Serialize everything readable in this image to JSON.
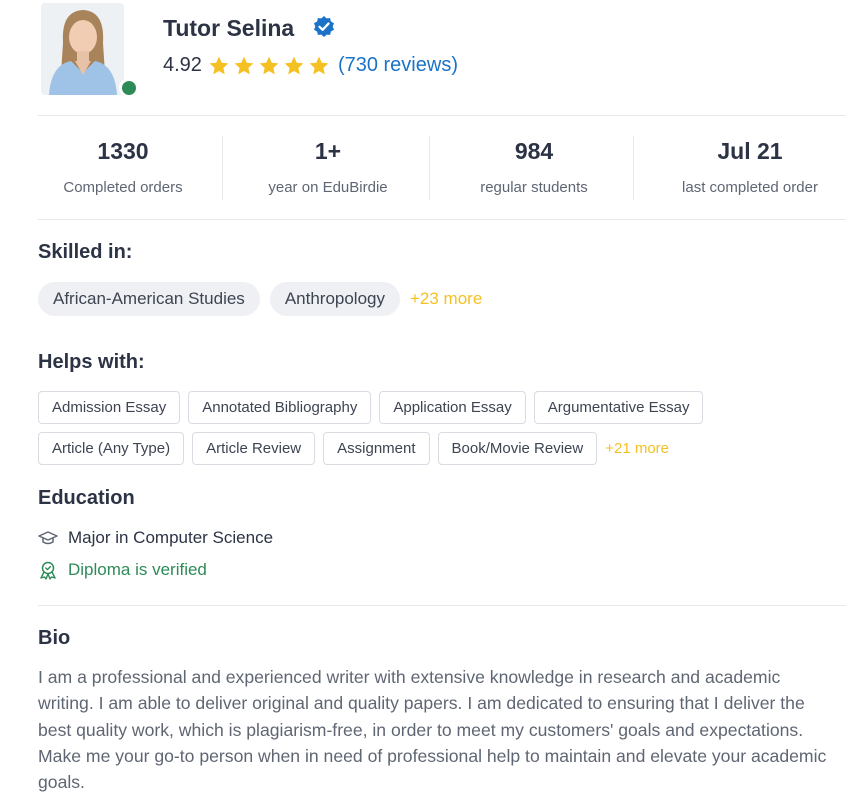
{
  "tutor": {
    "name": "Tutor Selina",
    "rating": "4.92",
    "stars": 5,
    "reviews_label": "(730 reviews)"
  },
  "stats": [
    {
      "value": "1330",
      "label": "Completed orders"
    },
    {
      "value": "1+",
      "label": "year on EduBirdie"
    },
    {
      "value": "984",
      "label": "regular students"
    },
    {
      "value": "Jul 21",
      "label": "last completed order"
    }
  ],
  "skills": {
    "title": "Skilled in:",
    "items": [
      "African-American Studies",
      "Anthropology"
    ],
    "more_label": "+23 more"
  },
  "helps": {
    "title": "Helps with:",
    "row1": [
      "Admission Essay",
      "Annotated Bibliography",
      "Application Essay",
      "Argumentative Essay"
    ],
    "row2": [
      "Article (Any Type)",
      "Article Review",
      "Assignment",
      "Book/Movie Review"
    ],
    "more_label": "+21 more"
  },
  "education": {
    "title": "Education",
    "major": "Major in Computer Science",
    "verified_label": "Diploma is verified"
  },
  "bio": {
    "title": "Bio",
    "text": "I am a professional and experienced writer with extensive knowledge in research and academic writing. I am able to deliver original and quality papers. I am dedicated to ensuring that I deliver the best quality work, which is plagiarism-free, in order to meet my customers' goals and expectations. Make me your go-to person when in need of professional help to maintain and elevate your academic goals."
  },
  "colors": {
    "accent_blue": "#1a73c8",
    "star_yellow": "#f5c122",
    "verified_green": "#2e8b57",
    "online_green": "#2e8b57"
  },
  "icons": {
    "verified": "verified-badge-icon",
    "star": "star-icon",
    "education": "graduation-cap-icon",
    "diploma": "award-ribbon-icon"
  }
}
